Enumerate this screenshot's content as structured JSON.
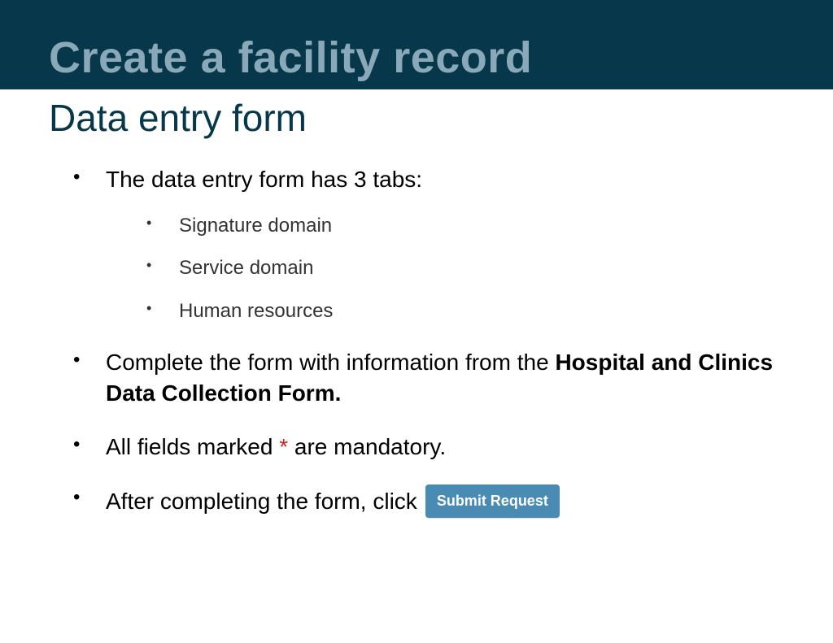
{
  "header": {
    "title": "Create a facility record",
    "subtitle": "Data entry form"
  },
  "bullets": {
    "b1": "The data entry form has 3 tabs:",
    "sub1": "Signature domain",
    "sub2": "Service domain",
    "sub3": "Human resources",
    "b2a": "Complete the form with information from the ",
    "b2b": "Hospital and Clinics Data Collection Form.",
    "b3a": "All fields marked ",
    "b3_ast": "*",
    "b3b": " are mandatory.",
    "b4": "After completing the form, click",
    "button_label": "Submit Request"
  }
}
